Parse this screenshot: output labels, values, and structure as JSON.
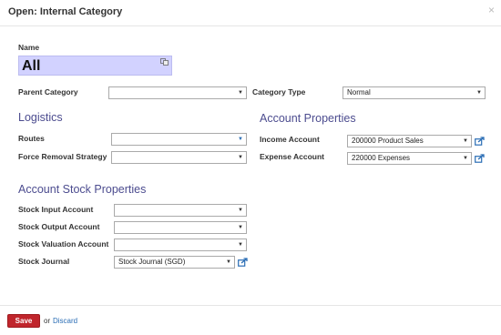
{
  "dialog": {
    "title": "Open: Internal Category",
    "close_glyph": "×"
  },
  "form": {
    "name_label": "Name",
    "name_value": "All",
    "parent_category_label": "Parent Category",
    "parent_category_value": "",
    "category_type_label": "Category Type",
    "category_type_value": "Normal"
  },
  "logistics": {
    "title": "Logistics",
    "routes_label": "Routes",
    "routes_value": "",
    "force_removal_label": "Force Removal Strategy",
    "force_removal_value": ""
  },
  "account_properties": {
    "title": "Account Properties",
    "income_label": "Income Account",
    "income_value": "200000 Product Sales",
    "expense_label": "Expense Account",
    "expense_value": "220000 Expenses"
  },
  "stock_properties": {
    "title": "Account Stock Properties",
    "input_label": "Stock Input Account",
    "input_value": "",
    "output_label": "Stock Output Account",
    "output_value": "",
    "valuation_label": "Stock Valuation Account",
    "valuation_value": "",
    "journal_label": "Stock Journal",
    "journal_value": "Stock Journal (SGD)"
  },
  "footer": {
    "save_label": "Save",
    "or_text": "or",
    "discard_label": "Discard"
  },
  "icons": {
    "dropdown_arrow": "▼",
    "translate": "translate-icon",
    "external_link": "external-link-icon"
  },
  "colors": {
    "section_title": "#4c4c8f",
    "name_background": "#d2d2ff",
    "save_button": "#c0252c",
    "link": "#2a6db5"
  }
}
